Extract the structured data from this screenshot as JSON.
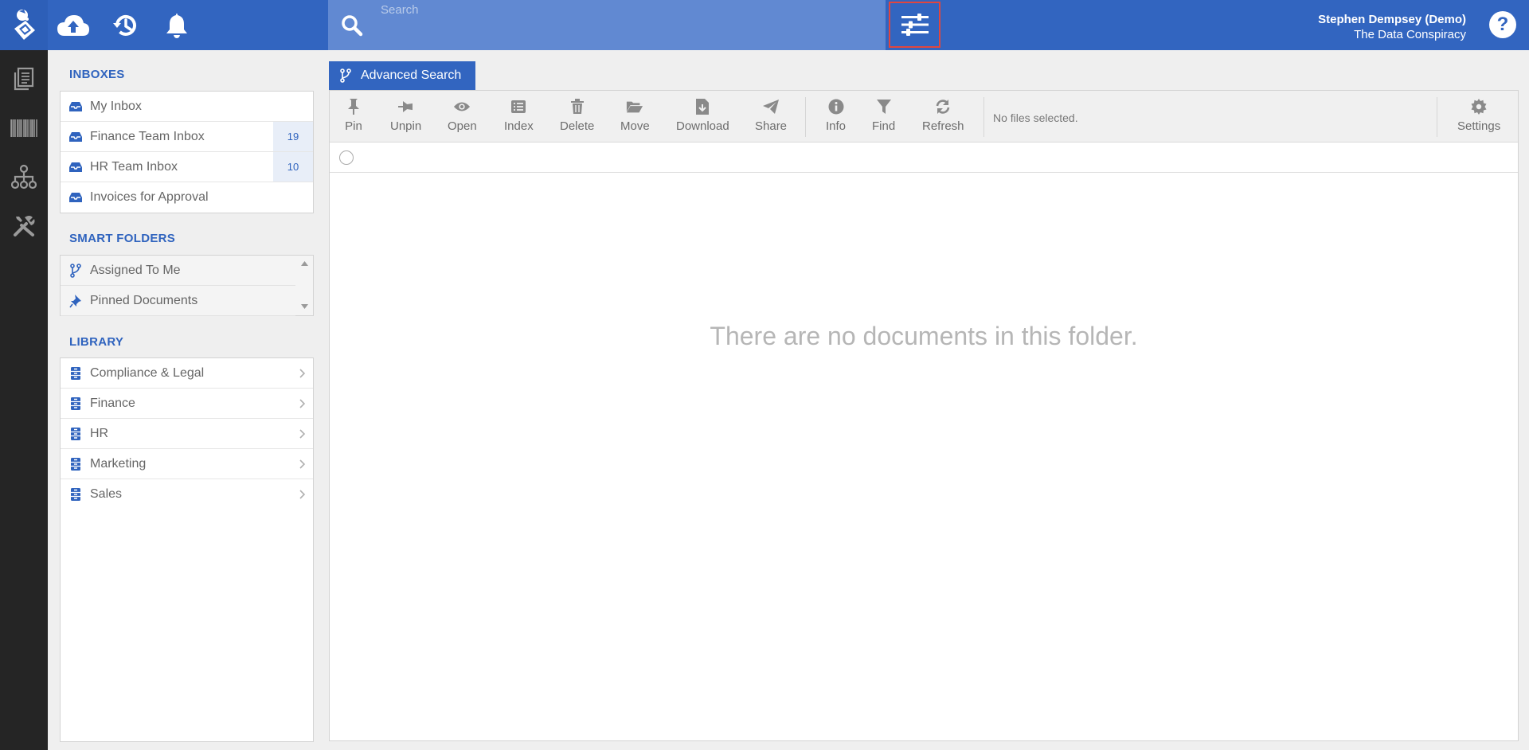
{
  "colors": {
    "brand": "#3265c0",
    "accent": "#e0463f",
    "rail": "#252525",
    "count_badge": "#e8eef8"
  },
  "topbar": {
    "icons": [
      "logo-icon",
      "cloud-upload-icon",
      "history-icon",
      "bell-icon"
    ],
    "search": {
      "placeholder": "Search"
    },
    "filter_icon": "sliders-icon",
    "user": {
      "name": "Stephen Dempsey (Demo)",
      "org": "The Data Conspiracy"
    },
    "help_label": "?"
  },
  "rail": {
    "items": [
      "documents-icon",
      "barcode-icon",
      "org-chart-icon",
      "tools-icon"
    ]
  },
  "sidebar": {
    "inboxes": {
      "title": "INBOXES",
      "items": [
        {
          "label": "My Inbox",
          "count": ""
        },
        {
          "label": "Finance Team Inbox",
          "count": "19"
        },
        {
          "label": "HR Team Inbox",
          "count": "10"
        },
        {
          "label": "Invoices for Approval",
          "count": ""
        }
      ]
    },
    "smart_folders": {
      "title": "SMART FOLDERS",
      "items": [
        {
          "label": "Assigned To Me",
          "icon": "branch-icon"
        },
        {
          "label": "Pinned Documents",
          "icon": "pin-icon"
        }
      ]
    },
    "library": {
      "title": "LIBRARY",
      "items": [
        {
          "label": "Compliance & Legal"
        },
        {
          "label": "Finance"
        },
        {
          "label": "HR"
        },
        {
          "label": "Marketing"
        },
        {
          "label": "Sales"
        }
      ]
    }
  },
  "main": {
    "tab_label": "Advanced Search",
    "toolbar": {
      "pin": "Pin",
      "unpin": "Unpin",
      "open": "Open",
      "index": "Index",
      "delete": "Delete",
      "move": "Move",
      "download": "Download",
      "share": "Share",
      "info": "Info",
      "find": "Find",
      "refresh": "Refresh",
      "settings": "Settings"
    },
    "status": "No files selected.",
    "empty_message": "There are no documents in this folder."
  }
}
